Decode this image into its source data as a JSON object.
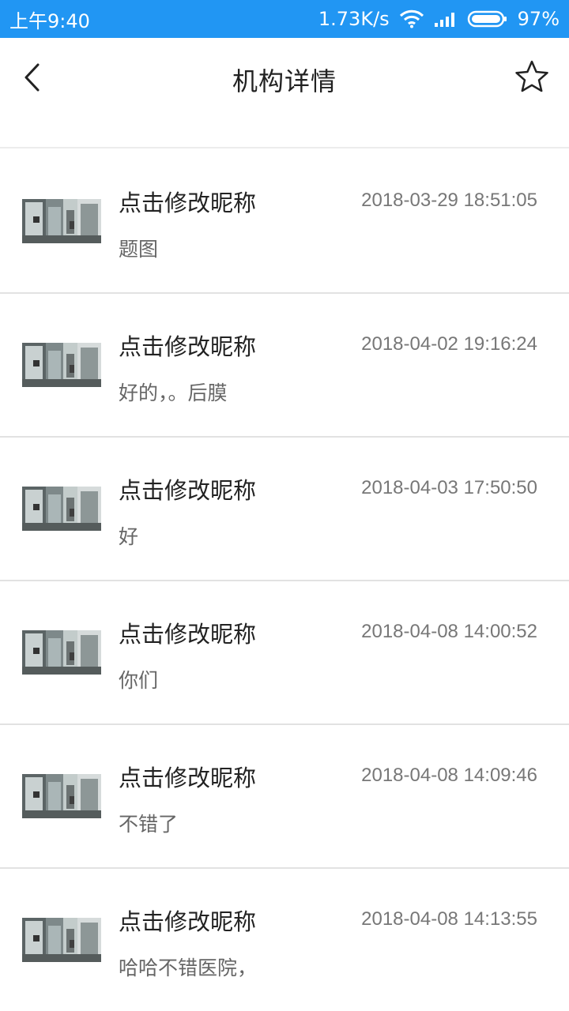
{
  "status_bar": {
    "time": "上午9:40",
    "speed": "1.73K/s",
    "battery": "97%",
    "bg_color": "#2196f3"
  },
  "header": {
    "title": "机构详情"
  },
  "comments": [
    {
      "nickname": "点击修改昵称",
      "time": "2018-03-29 18:51:05",
      "text": "题图"
    },
    {
      "nickname": "点击修改昵称",
      "time": "2018-04-02 19:16:24",
      "text": "好的，。后膜"
    },
    {
      "nickname": "点击修改昵称",
      "time": "2018-04-03 17:50:50",
      "text": "好"
    },
    {
      "nickname": "点击修改昵称",
      "time": "2018-04-08 14:00:52",
      "text": "你们"
    },
    {
      "nickname": "点击修改昵称",
      "time": "2018-04-08 14:09:46",
      "text": "不错了"
    },
    {
      "nickname": "点击修改昵称",
      "time": "2018-04-08 14:13:55",
      "text": "哈哈不错医院，"
    }
  ]
}
